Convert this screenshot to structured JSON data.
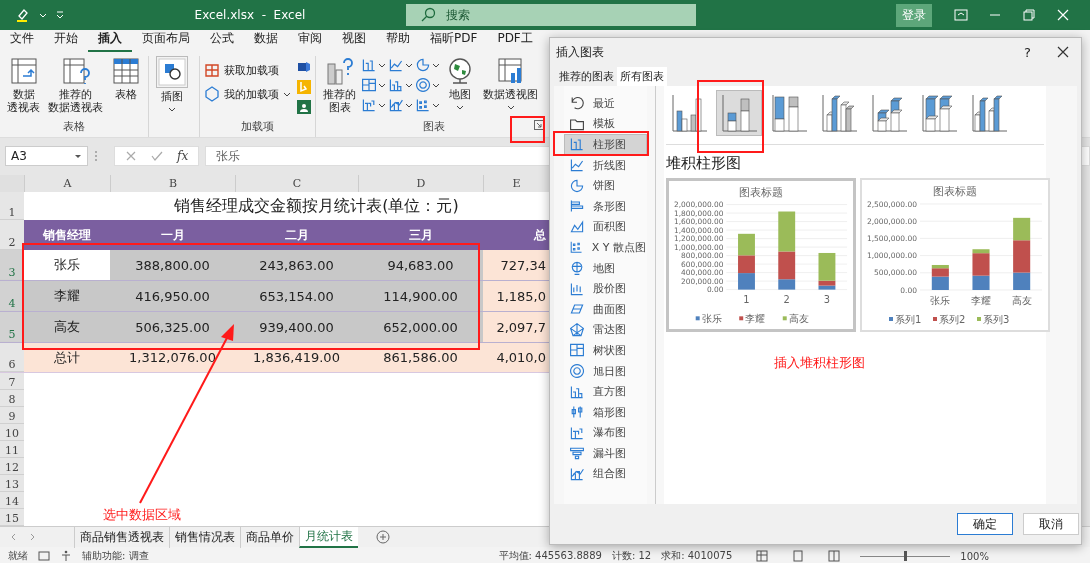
{
  "title_bar": {
    "title": "Excel.xlsx  -  Excel",
    "search": {
      "placeholder": "搜索"
    },
    "sign_in": "登录"
  },
  "ribbon": {
    "tabs": [
      {
        "label": "文件",
        "selected": false
      },
      {
        "label": "开始",
        "selected": false
      },
      {
        "label": "插入",
        "selected": true
      },
      {
        "label": "页面布局",
        "selected": false
      },
      {
        "label": "公式",
        "selected": false
      },
      {
        "label": "数据",
        "selected": false
      },
      {
        "label": "审阅",
        "selected": false
      },
      {
        "label": "视图",
        "selected": false
      },
      {
        "label": "帮助",
        "selected": false
      },
      {
        "label": "福昕PDF",
        "selected": false
      },
      {
        "label": "PDF工",
        "selected": false
      }
    ],
    "table_group": {
      "label": "表格",
      "buttons": [
        [
          "数据",
          "透视表"
        ],
        [
          "推荐的",
          "数据透视表"
        ],
        [
          "表格"
        ]
      ]
    },
    "illustrations_button": "插图",
    "addins_group": {
      "label": "加载项",
      "buttons": [
        "获取加载项",
        "我的加载项"
      ]
    },
    "charts_group": {
      "label": "图表",
      "buttons": [
        [
          "推荐的",
          "图表"
        ],
        [
          "地图"
        ],
        [
          "数据透视图"
        ]
      ]
    }
  },
  "formula_bar": {
    "name_box": "A3",
    "fx": "fx",
    "value": "张乐"
  },
  "sheet": {
    "columns": [
      "A",
      "B",
      "C",
      "D",
      "E"
    ],
    "rows": [
      {
        "number": "1",
        "kind": "title",
        "selected": false,
        "text": "销售经理成交金额按月统计表(单位：元)"
      },
      {
        "number": "2",
        "kind": "header",
        "selected": false,
        "cells": [
          "销售经理",
          "一月",
          "二月",
          "三月",
          "总"
        ]
      },
      {
        "number": "3",
        "kind": "data",
        "selected": true,
        "cursor": true,
        "cells": [
          "张乐",
          "388,800.00",
          "243,863.00",
          "94,683.00",
          "727,34"
        ]
      },
      {
        "number": "4",
        "kind": "data",
        "selected": true,
        "cursor": false,
        "cells": [
          "李耀",
          "416,950.00",
          "653,154.00",
          "114,900.00",
          "1,185,0"
        ]
      },
      {
        "number": "5",
        "kind": "data",
        "selected": true,
        "cursor": false,
        "cells": [
          "高友",
          "506,325.00",
          "939,400.00",
          "652,000.00",
          "2,097,7"
        ]
      },
      {
        "number": "6",
        "kind": "total",
        "selected": false,
        "cells": [
          "总计",
          "1,312,076.00",
          "1,836,419.00",
          "861,586.00",
          "4,010,0"
        ]
      },
      {
        "number": "7",
        "kind": "empty",
        "selected": false
      },
      {
        "number": "8",
        "kind": "empty",
        "selected": false
      },
      {
        "number": "9",
        "kind": "empty",
        "selected": false
      },
      {
        "number": "10",
        "kind": "empty",
        "selected": false
      },
      {
        "number": "11",
        "kind": "empty",
        "selected": false
      },
      {
        "number": "12",
        "kind": "empty",
        "selected": false
      },
      {
        "number": "13",
        "kind": "empty",
        "selected": false
      },
      {
        "number": "14",
        "kind": "empty",
        "selected": false
      },
      {
        "number": "15",
        "kind": "empty",
        "selected": false
      }
    ]
  },
  "sheet_tabs": [
    {
      "label": "商品销售透视表",
      "selected": false
    },
    {
      "label": "销售情况表",
      "selected": false
    },
    {
      "label": "商品单价",
      "selected": false
    },
    {
      "label": "月统计表",
      "selected": true
    }
  ],
  "status_bar": {
    "ready": "就绪",
    "accessibility": "辅助功能: 调查",
    "average": "平均值: 445563.8889",
    "count": "计数: 12",
    "sum": "求和: 4010075",
    "zoom": "100%",
    "zoom_slider": {
      "level": 0.5
    }
  },
  "dialog": {
    "title": "插入图表",
    "help": "?",
    "tabs": [
      {
        "label": "推荐的图表",
        "selected": false
      },
      {
        "label": "所有图表",
        "selected": true
      }
    ],
    "categories": [
      {
        "label": "最近",
        "selected": false
      },
      {
        "label": "模板",
        "selected": false
      },
      {
        "label": "柱形图",
        "selected": true
      },
      {
        "label": "折线图",
        "selected": false
      },
      {
        "label": "饼图",
        "selected": false
      },
      {
        "label": "条形图",
        "selected": false
      },
      {
        "label": "面积图",
        "selected": false
      },
      {
        "label": "X Y 散点图",
        "selected": false
      },
      {
        "label": "地图",
        "selected": false
      },
      {
        "label": "股价图",
        "selected": false
      },
      {
        "label": "曲面图",
        "selected": false
      },
      {
        "label": "雷达图",
        "selected": false
      },
      {
        "label": "树状图",
        "selected": false
      },
      {
        "label": "旭日图",
        "selected": false
      },
      {
        "label": "直方图",
        "selected": false
      },
      {
        "label": "箱形图",
        "selected": false
      },
      {
        "label": "瀑布图",
        "selected": false
      },
      {
        "label": "漏斗图",
        "selected": false
      },
      {
        "label": "组合图",
        "selected": false
      }
    ],
    "subtypes": [
      {
        "kind": "clustered",
        "selected": false
      },
      {
        "kind": "stacked",
        "selected": true
      },
      {
        "kind": "percent",
        "selected": false
      },
      {
        "kind": "clustered3d",
        "selected": false
      },
      {
        "kind": "stacked3d",
        "selected": false
      },
      {
        "kind": "percent3d",
        "selected": false
      },
      {
        "kind": "column3d",
        "selected": false
      }
    ],
    "subtype_title": "堆积柱形图",
    "previews": [
      {
        "selected": true,
        "chart_data": {
          "type": "bar",
          "title": "图表标题",
          "stacked": true,
          "grid": true,
          "legend": "bottom",
          "categories": [
            "1",
            "2",
            "3"
          ],
          "series": [
            {
              "name": "张乐",
              "color": "#4f81bd",
              "values": [
                388800,
                243863,
                94683
              ]
            },
            {
              "name": "李耀",
              "color": "#c0504d",
              "values": [
                416950,
                653154,
                114900
              ]
            },
            {
              "name": "高友",
              "color": "#9bbb59",
              "values": [
                506325,
                939400,
                652000
              ]
            }
          ],
          "ylim": [
            0,
            2000000
          ],
          "yticks": [
            {
              "value": 0,
              "label": "0.00"
            },
            {
              "value": 200000,
              "label": "200,000.00"
            },
            {
              "value": 400000,
              "label": "400,000.00"
            },
            {
              "value": 600000,
              "label": "600,000.00"
            },
            {
              "value": 800000,
              "label": "800,000.00"
            },
            {
              "value": 1000000,
              "label": "1,000,000.00"
            },
            {
              "value": 1200000,
              "label": "1,200,000.00"
            },
            {
              "value": 1400000,
              "label": "1,400,000.00"
            },
            {
              "value": 1600000,
              "label": "1,600,000.00"
            },
            {
              "value": 1800000,
              "label": "1,800,000.00"
            },
            {
              "value": 2000000,
              "label": "2,000,000.00"
            }
          ]
        }
      },
      {
        "selected": false,
        "chart_data": {
          "type": "bar",
          "title": "图表标题",
          "stacked": true,
          "grid": true,
          "legend": "bottom",
          "categories": [
            "张乐",
            "李耀",
            "高友"
          ],
          "series": [
            {
              "name": "系列1",
              "color": "#4f81bd",
              "values": [
                388800,
                416950,
                506325
              ]
            },
            {
              "name": "系列2",
              "color": "#c0504d",
              "values": [
                243863,
                653154,
                939400
              ]
            },
            {
              "name": "系列3",
              "color": "#9bbb59",
              "values": [
                94683,
                114900,
                652000
              ]
            }
          ],
          "ylim": [
            0,
            2500000
          ],
          "yticks": [
            {
              "value": 0,
              "label": "0.00"
            },
            {
              "value": 500000,
              "label": "500,000.00"
            },
            {
              "value": 1000000,
              "label": "1,000,000.00"
            },
            {
              "value": 1500000,
              "label": "1,500,000.00"
            },
            {
              "value": 2000000,
              "label": "2,000,000.00"
            },
            {
              "value": 2500000,
              "label": "2,500,000.00"
            }
          ]
        }
      }
    ],
    "buttons": [
      "确定",
      "取消"
    ]
  },
  "annotations": [
    {
      "text": "选中数据区域"
    },
    {
      "text": "插入堆积柱形图"
    }
  ]
}
